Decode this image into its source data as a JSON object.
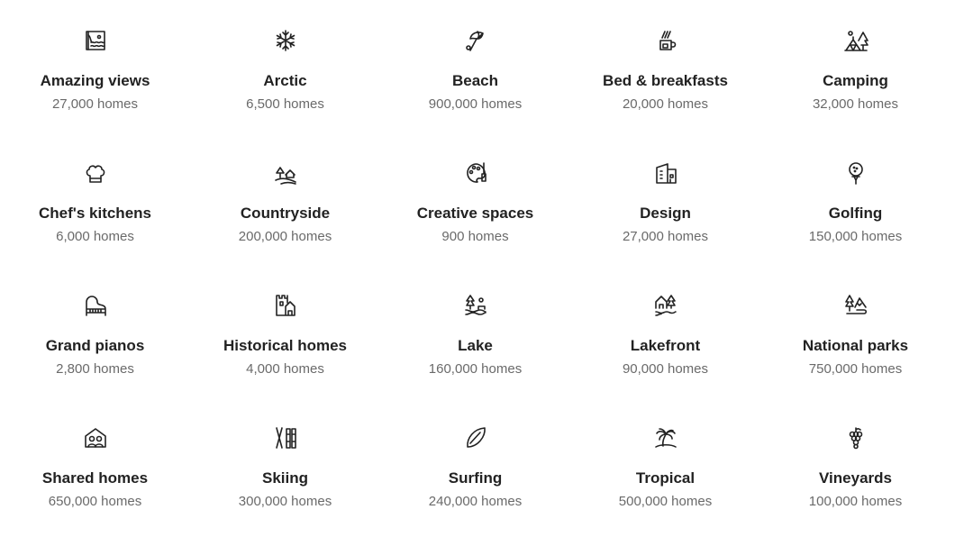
{
  "categories": [
    {
      "title": "Amazing views",
      "count": "27,000 homes",
      "icon": "framed-landscape-icon"
    },
    {
      "title": "Arctic",
      "count": "6,500 homes",
      "icon": "snowflake-icon"
    },
    {
      "title": "Beach",
      "count": "900,000 homes",
      "icon": "beach-umbrella-icon"
    },
    {
      "title": "Bed & breakfasts",
      "count": "20,000 homes",
      "icon": "coffee-mug-icon"
    },
    {
      "title": "Camping",
      "count": "32,000 homes",
      "icon": "tent-icon"
    },
    {
      "title": "Chef's kitchens",
      "count": "6,000 homes",
      "icon": "chef-hat-icon"
    },
    {
      "title": "Countryside",
      "count": "200,000 homes",
      "icon": "countryside-icon"
    },
    {
      "title": "Creative spaces",
      "count": "900 homes",
      "icon": "palette-icon"
    },
    {
      "title": "Design",
      "count": "27,000 homes",
      "icon": "modern-building-icon"
    },
    {
      "title": "Golfing",
      "count": "150,000 homes",
      "icon": "golf-ball-icon"
    },
    {
      "title": "Grand pianos",
      "count": "2,800 homes",
      "icon": "piano-icon"
    },
    {
      "title": "Historical homes",
      "count": "4,000 homes",
      "icon": "castle-icon"
    },
    {
      "title": "Lake",
      "count": "160,000 homes",
      "icon": "lake-icon"
    },
    {
      "title": "Lakefront",
      "count": "90,000 homes",
      "icon": "lakefront-house-icon"
    },
    {
      "title": "National parks",
      "count": "750,000 homes",
      "icon": "mountains-trees-icon"
    },
    {
      "title": "Shared homes",
      "count": "650,000 homes",
      "icon": "shared-home-icon"
    },
    {
      "title": "Skiing",
      "count": "300,000 homes",
      "icon": "skis-icon"
    },
    {
      "title": "Surfing",
      "count": "240,000 homes",
      "icon": "surfboard-icon"
    },
    {
      "title": "Tropical",
      "count": "500,000 homes",
      "icon": "palm-tree-icon"
    },
    {
      "title": "Vineyards",
      "count": "100,000 homes",
      "icon": "grapes-icon"
    }
  ]
}
